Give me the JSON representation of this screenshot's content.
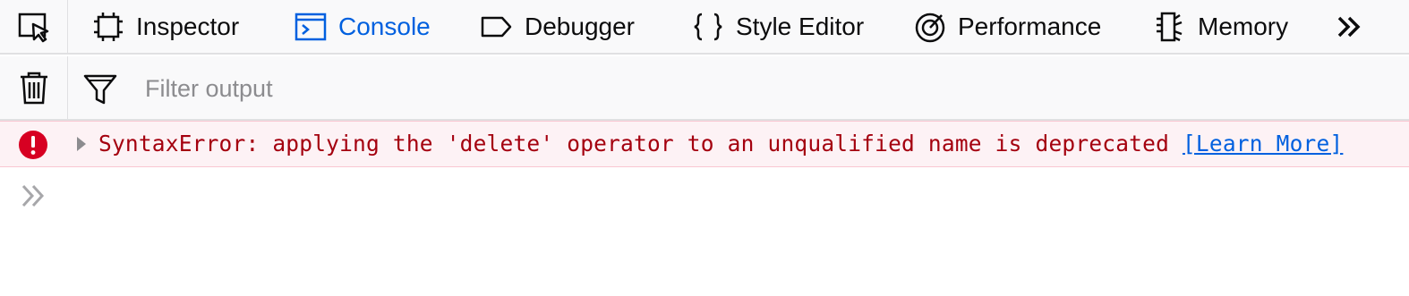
{
  "toolbox": {
    "tabs": [
      {
        "label": "Inspector",
        "icon": "inspector-icon",
        "active": false
      },
      {
        "label": "Console",
        "icon": "console-icon",
        "active": true
      },
      {
        "label": "Debugger",
        "icon": "debugger-icon",
        "active": false
      },
      {
        "label": "Style Editor",
        "icon": "style-editor-icon",
        "active": false
      },
      {
        "label": "Performance",
        "icon": "performance-icon",
        "active": false
      },
      {
        "label": "Memory",
        "icon": "memory-icon",
        "active": false
      }
    ],
    "active_color": "#0060df"
  },
  "filter": {
    "placeholder": "Filter output",
    "value": ""
  },
  "messages": [
    {
      "level": "error",
      "text": "SyntaxError: applying the 'delete' operator to an unqualified name is deprecated",
      "link": "[Learn More]",
      "text_color": "#a4000f",
      "background": "#fdf2f5"
    }
  ],
  "jsterm": {
    "value": ""
  }
}
